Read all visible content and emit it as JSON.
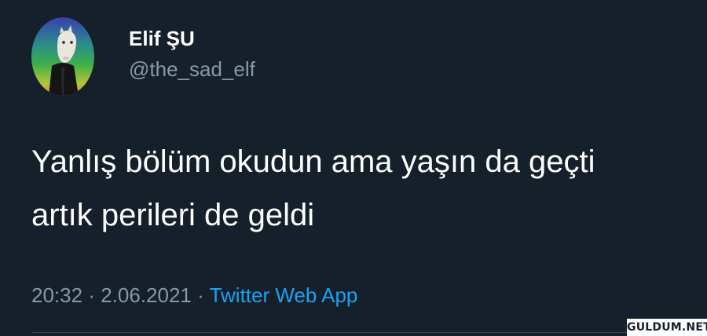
{
  "user": {
    "display_name": "Elif ŞU",
    "handle": "@the_sad_elf"
  },
  "tweet": {
    "lines": [
      "Yanlış bölüm okudun ama yaşın da geçti",
      "artık perileri de geldi"
    ]
  },
  "meta": {
    "time": "20:32",
    "separator": "·",
    "date": "2.06.2021",
    "source": "Twitter Web App"
  },
  "watermark": "GULDUM.NET",
  "colors": {
    "background": "#15202b",
    "primary_text": "#ffffff",
    "secondary_text": "#8899a6",
    "link": "#1da1f2"
  },
  "icons": {
    "avatar": "horse-mask-portrait"
  }
}
